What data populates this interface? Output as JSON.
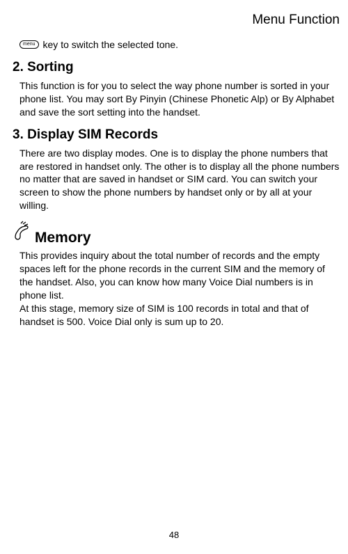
{
  "header": {
    "title": "Menu Function"
  },
  "menu_key": {
    "icon_label": "menu",
    "text": "key to switch the selected tone."
  },
  "section_sorting": {
    "title": "2. Sorting",
    "body": "This function is for you to select the way phone number is sorted in your phone list. You may sort By Pinyin (Chinese Phonetic Alp) or By Alphabet and save the sort setting into the handset."
  },
  "section_display": {
    "title": "3. Display SIM Records",
    "body": "There are two display modes.    One is to display the phone numbers that are restored in handset only.    The other is to display all the phone numbers no matter that are saved in handset or SIM card.    You can switch your screen to show the phone numbers by handset only or by all at your willing."
  },
  "section_memory": {
    "title": "Memory",
    "body1": "This provides inquiry about the total number of records and the empty spaces left for the phone records in the current SIM and the memory of the handset. Also, you can know how many Voice Dial numbers is in phone list.",
    "body2": "At this stage, memory size of SIM is 100 records in total and that of handset is 500.   Voice Dial only is sum up to 20."
  },
  "page_number": "48"
}
